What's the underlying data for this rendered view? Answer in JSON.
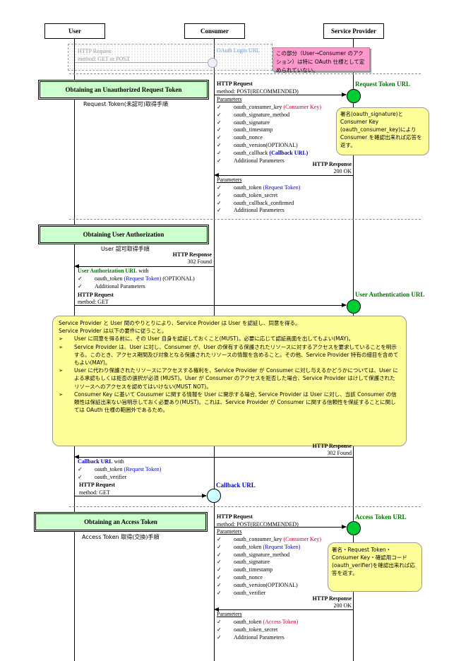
{
  "actors": {
    "user": "User",
    "consumer": "Consumer",
    "provider": "Service Provider"
  },
  "top": {
    "user_req_title": "HTTP Request",
    "user_req_method": "method: GET or POST",
    "oauth_login": "OAuth Login URL",
    "pink_note": "この部分（User→Consumer のアクション）は特に OAuth 仕様として定められていない。"
  },
  "phase1": {
    "title": "Obtaining an Unauthorized Request Token",
    "subtitle": "Request Token(未認可)取得手順",
    "req_title": "HTTP Request",
    "req_method": "method: POST(RECOMMENDED)",
    "endpoint": "Request Token URL",
    "params_label": "Parameters",
    "params": [
      {
        "name": "oauth_consumer_key",
        "note": "(Consumer Key)",
        "color": "#cc0033"
      },
      {
        "name": "oauth_signature_method",
        "note": "",
        "color": ""
      },
      {
        "name": "oauth_signature",
        "note": "",
        "color": ""
      },
      {
        "name": "oauth_timestamp",
        "note": "",
        "color": ""
      },
      {
        "name": "oauth_nonce",
        "note": "",
        "color": ""
      },
      {
        "name": "oauth_version(OPTIONAL)",
        "note": "",
        "color": ""
      },
      {
        "name": "oauth_callback",
        "note": "(Callback URL)",
        "color": "#0000cc"
      },
      {
        "name": "Additional Parameters",
        "note": "",
        "color": ""
      }
    ],
    "note": "署名(oauth_signature)と Consumer Key (oauth_consumer_key)により Consumer を確認出来れば応答を返す。",
    "resp_title": "HTTP Response",
    "resp_status": "200  OK",
    "resp_params_label": "Parameters",
    "resp_params": [
      {
        "name": "oauth_token",
        "note": "(Request Token)",
        "color": "#0000cc"
      },
      {
        "name": "oauth_token_secret",
        "note": "",
        "color": ""
      },
      {
        "name": "oauth_callback_confirmed",
        "note": "",
        "color": ""
      },
      {
        "name": "Additional Parameters",
        "note": "",
        "color": ""
      }
    ]
  },
  "phase2": {
    "title": "Obtaining User Authorization",
    "subtitle": "User 認可取得手順",
    "resp_title": "HTTP Response",
    "resp_status": "302  Found",
    "auth_url": "User Authorization URL",
    "with": " with",
    "auth_params": [
      {
        "name": "oauth_token",
        "note": "(Request Token)",
        "color": "#0000cc",
        "suffix": " (OPTIONAL)"
      },
      {
        "name": "Additional Parameters",
        "note": "",
        "color": "",
        "suffix": ""
      }
    ],
    "req_title": "HTTP Request",
    "req_method": "method: GET",
    "endpoint": "User Authentication URL",
    "big_note_intro": [
      "Service Provider と User 間のやりとりにより、Service Provider は User を認証し、同意を得る。",
      "Service Provider は以下の要件に従うこと。"
    ],
    "big_note_items": [
      "User に同意を得る前に、その User 自身を認証しておくこと(MUST)。必要に応じて認証画面を出してもよい(MAY)。",
      "Service Provider は、User に対し、Consumer が、User の保有する保護されたリソースに対するアクセスを要求していることを明示する。このとき、アクセス期間及び対象となる保護されたリソースの情報を含めること。その他、Service Provider 特有の細目を含めてもよい(MAY)。",
      "User に代わり保護されたリソースにアクセスする権利を、Service Provider が Consumer に対し与えるかどうかについては、User による承認もしくは拒否の選択が必須 (MUST)。User が Consumer のアクセスを拒否した場合、Service Provider はけして保護されたリソースへのアクセスを認めてはいけない(MUST NOT)。",
      "Consumer Key に基いて Cousumer に関する情報を User に開示する場合, Service Provider は User に対し、当該 Consumer の信頼性は保証出来ない旨明示しておく必要あり(MUST)。これは、Service Provider が Consumer に関する信頼性を保証することに関しては OAuth 仕様の範囲外であるため。"
    ],
    "cb_resp_title": "HTTP Response",
    "cb_resp_status": "302  Found",
    "cb_url": "Callback URL",
    "cb_with": " with",
    "cb_params": [
      {
        "name": "oauth_token",
        "note": "(Request Token)",
        "color": "#0000cc"
      },
      {
        "name": "oauth_verifier",
        "note": "",
        "color": ""
      }
    ],
    "cb_req_title": "HTTP Request",
    "cb_req_method": "method: GET",
    "cb_endpoint": "Callback URL"
  },
  "phase3": {
    "title": "Obtaining an Access Token",
    "subtitle": "Access Token 取得(交換)手順",
    "req_title": "HTTP Request",
    "req_method": "method: POST(RECOMMENDED)",
    "endpoint": "Access Token URL",
    "params_label": "Parameters",
    "params": [
      {
        "name": "oauth_consumer_key",
        "note": "(Consumer Key)",
        "color": "#cc0033"
      },
      {
        "name": "oauth_token",
        "note": "(Request Token)",
        "color": "#0000cc"
      },
      {
        "name": "oauth_signature_method",
        "note": "",
        "color": ""
      },
      {
        "name": "oauth_signature",
        "note": "",
        "color": ""
      },
      {
        "name": "oauth_timestamp",
        "note": "",
        "color": ""
      },
      {
        "name": "oauth_nonce",
        "note": "",
        "color": ""
      },
      {
        "name": "oauth_version(OPTIONAL)",
        "note": "",
        "color": ""
      },
      {
        "name": "oauth_verifier",
        "note": "",
        "color": ""
      }
    ],
    "note": "署名・Request Token・Consumer Key・確認用コード(oauth_verifier)を確認出来れば応答を返す。",
    "resp_title": "HTTP Response",
    "resp_status": "200  OK",
    "resp_params_label": "Parameters",
    "resp_params": [
      {
        "name": "oauth_token",
        "note": "(Access Token)",
        "color": "#cc0033"
      },
      {
        "name": "oauth_token_secret",
        "note": "",
        "color": ""
      },
      {
        "name": "Additional Parameters",
        "note": "",
        "color": ""
      }
    ]
  },
  "check_glyph": "✓",
  "bullet_glyph": "➢"
}
